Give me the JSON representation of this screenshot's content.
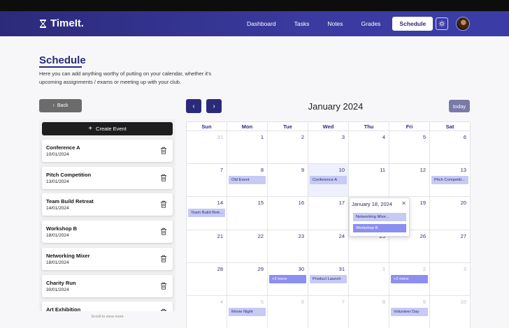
{
  "app": {
    "name": "TimeIt."
  },
  "nav": {
    "links": [
      "Dashboard",
      "Tasks",
      "Notes",
      "Grades"
    ],
    "active": "Schedule"
  },
  "page": {
    "title": "Schedule",
    "description": "Here you can add anything worthy of putting on your calendar, whether it's upcoming assignments / exams or meeting up with your club.",
    "back_label": "Back",
    "create_label": "Create Event",
    "scroll_hint": "Scroll to view more"
  },
  "events": [
    {
      "name": "Conference A",
      "date": "10/01/2024"
    },
    {
      "name": "Pitch Competition",
      "date": "13/01/2024"
    },
    {
      "name": "Team Build Retreat",
      "date": "14/01/2024"
    },
    {
      "name": "Workshop B",
      "date": "18/01/2024"
    },
    {
      "name": "Networking Mixer",
      "date": "18/01/2024"
    },
    {
      "name": "Charity Run",
      "date": "30/01/2024"
    },
    {
      "name": "Art Exhibition",
      "date": ""
    }
  ],
  "calendar": {
    "month": "January 2024",
    "today_label": "today",
    "weekdays": [
      "Sun",
      "Mon",
      "Tue",
      "Wed",
      "Thu",
      "Fri",
      "Sat"
    ],
    "weeks": [
      [
        {
          "d": "31",
          "o": true
        },
        {
          "d": "1"
        },
        {
          "d": "2"
        },
        {
          "d": "3"
        },
        {
          "d": "4"
        },
        {
          "d": "5"
        },
        {
          "d": "6"
        }
      ],
      [
        {
          "d": "7"
        },
        {
          "d": "8",
          "chip": "Old Event"
        },
        {
          "d": "9"
        },
        {
          "d": "10",
          "chip": "Conference A",
          "hl": true
        },
        {
          "d": "11"
        },
        {
          "d": "12"
        },
        {
          "d": "13",
          "chip": "Pitch Competiti..."
        }
      ],
      [
        {
          "d": "14",
          "chip": "Team Build Retr..."
        },
        {
          "d": "15"
        },
        {
          "d": "16"
        },
        {
          "d": "17"
        },
        {
          "d": "18"
        },
        {
          "d": "19"
        },
        {
          "d": "20"
        }
      ],
      [
        {
          "d": "21"
        },
        {
          "d": "22"
        },
        {
          "d": "23"
        },
        {
          "d": "24"
        },
        {
          "d": "25"
        },
        {
          "d": "26"
        },
        {
          "d": "27"
        }
      ],
      [
        {
          "d": "28"
        },
        {
          "d": "29"
        },
        {
          "d": "30",
          "more": "+2 more"
        },
        {
          "d": "31",
          "chip": "Product Launch"
        },
        {
          "d": "1",
          "o": true
        },
        {
          "d": "2",
          "o": true,
          "more": "+2 more"
        },
        {
          "d": "3",
          "o": true
        }
      ],
      [
        {
          "d": "4",
          "o": true
        },
        {
          "d": "5",
          "o": true,
          "chip": "Movie Night"
        },
        {
          "d": "6",
          "o": true
        },
        {
          "d": "7",
          "o": true
        },
        {
          "d": "8",
          "o": true
        },
        {
          "d": "9",
          "o": true,
          "chip": "Volunteer Day"
        },
        {
          "d": "10",
          "o": true
        }
      ]
    ],
    "popover": {
      "title": "January 18, 2024",
      "items": [
        "Networking Mixe...",
        "Workshop B"
      ]
    }
  }
}
